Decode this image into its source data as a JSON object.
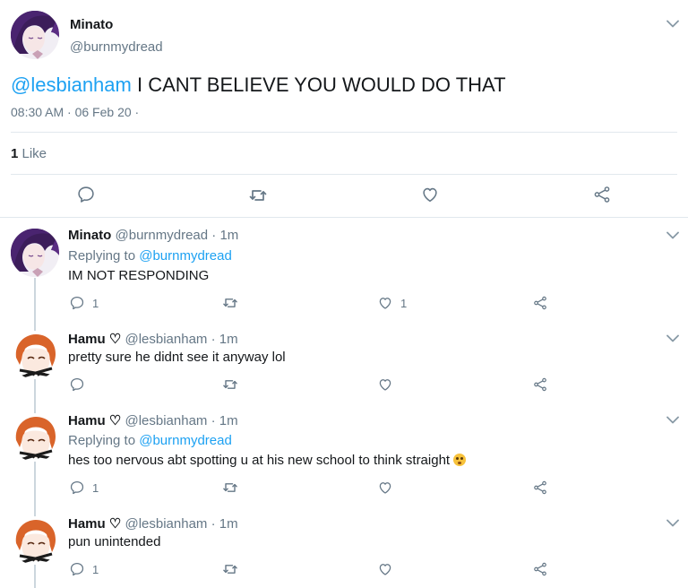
{
  "main": {
    "name": "Minato",
    "handle": "@burnmydread",
    "mention": "@lesbianham",
    "text": " I CANT BELIEVE YOU WOULD DO THAT",
    "time": "08:30 AM · 06 Feb 20 ·",
    "like_count": "1",
    "like_label": " Like"
  },
  "replies": [
    {
      "name": "Minato",
      "handle": "@burnmydread · 1m",
      "reply_label": "Replying to ",
      "reply_to": "@burnmydread",
      "text": "IM NOT RESPONDING",
      "reply_count": "1",
      "like_count": "1"
    },
    {
      "name": "Hamu ♡",
      "handle": "@lesbianham · 1m",
      "text": "pretty sure he didnt see it anyway lol"
    },
    {
      "name": "Hamu ♡",
      "handle": "@lesbianham · 1m",
      "reply_label": "Replying to ",
      "reply_to": "@burnmydread",
      "text": "hes too nervous abt spotting u at his new school to think straight",
      "reply_count": "1"
    },
    {
      "name": "Hamu ♡",
      "handle": "@lesbianham · 1m",
      "text": "pun unintended",
      "reply_count": "1"
    }
  ],
  "colors": {
    "accent": "#1da1f2",
    "secondary": "#657786",
    "divider": "#e1e8ed"
  }
}
